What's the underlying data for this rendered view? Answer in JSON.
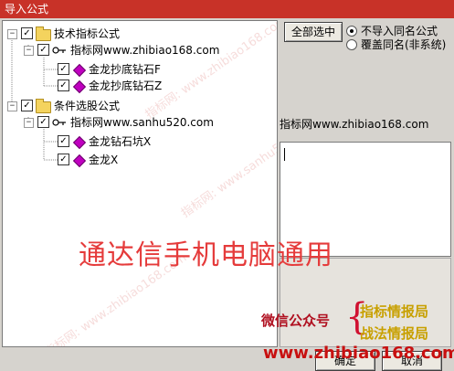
{
  "window": {
    "title": "导入公式"
  },
  "tree": {
    "groups": [
      {
        "label": "技术指标公式",
        "checked": true,
        "source": "指标网www.zhibiao168.com",
        "items": [
          "金龙抄底钻石F",
          "金龙抄底钻石Z"
        ]
      },
      {
        "label": "条件选股公式",
        "checked": true,
        "source": "指标网www.sanhu520.com",
        "items": [
          "金龙钻石坑X",
          "金龙X"
        ]
      }
    ],
    "expander_minus": "−",
    "check_mark": "✓"
  },
  "buttons": {
    "select_all": "全部选中",
    "ok": "确定",
    "cancel": "取消"
  },
  "options": {
    "no_import_same_name": "不导入同名公式",
    "overwrite_same_name": "覆盖同名(非系统)",
    "selected": "no_import_same_name"
  },
  "info": {
    "source_label": "指标网www.zhibiao168.com",
    "memo_text": ""
  },
  "overlay": {
    "main_text": "通达信手机电脑通用",
    "wechat_label": "微信公众号",
    "brand_1": "指标情报局",
    "brand_2": "战法情报局",
    "url": "www.zhibiao168.com",
    "watermark_1": "指标网: www.zhibiao168.com",
    "watermark_2": "指标网: www.sanhu520.com"
  },
  "colors": {
    "titlebar": "#c83228",
    "accent_red": "#e53b3b",
    "brand_gold": "#c8a000"
  }
}
